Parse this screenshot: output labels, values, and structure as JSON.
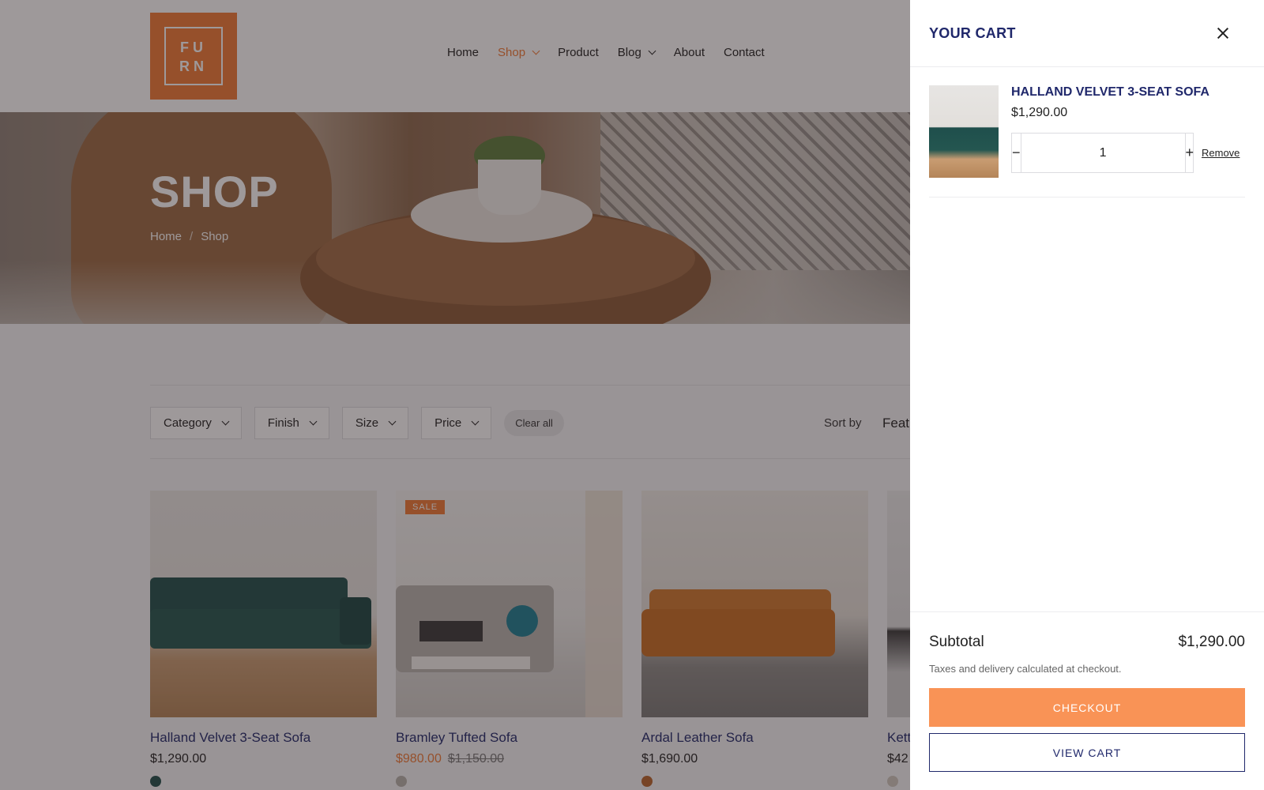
{
  "logo": {
    "line1": "FU",
    "line2": "RN"
  },
  "nav": [
    {
      "label": "Home",
      "active": false,
      "dropdown": false
    },
    {
      "label": "Shop",
      "active": true,
      "dropdown": true
    },
    {
      "label": "Product",
      "active": false,
      "dropdown": false
    },
    {
      "label": "Blog",
      "active": false,
      "dropdown": true
    },
    {
      "label": "About",
      "active": false,
      "dropdown": false
    },
    {
      "label": "Contact",
      "active": false,
      "dropdown": false
    }
  ],
  "hero": {
    "title": "SHOP",
    "breadcrumb": [
      "Home",
      "Shop"
    ],
    "breadcrumb_sep": "/"
  },
  "filters": {
    "buttons": [
      "Category",
      "Finish",
      "Size",
      "Price"
    ],
    "clear_label": "Clear all",
    "sort_label": "Sort by",
    "sort_value": "Feat"
  },
  "products": [
    {
      "name": "Halland Velvet 3-Seat Sofa",
      "price": "$1,290.00",
      "sale_price": "",
      "old_price": "",
      "badge": "",
      "swatch": "#1f4f4c"
    },
    {
      "name": "Bramley Tufted Sofa",
      "price": "",
      "sale_price": "$980.00",
      "old_price": "$1,150.00",
      "badge": "SALE",
      "swatch": "#b7b2ab"
    },
    {
      "name": "Ardal Leather Sofa",
      "price": "$1,690.00",
      "sale_price": "",
      "old_price": "",
      "badge": "",
      "swatch": "#b8652c"
    },
    {
      "name": "Kett",
      "price": "$42",
      "sale_price": "",
      "old_price": "",
      "badge": "",
      "swatch": "#cfc9c0"
    }
  ],
  "cart": {
    "title": "YOUR CART",
    "item": {
      "name": "HALLAND VELVET 3-SEAT SOFA",
      "price": "$1,290.00",
      "quantity": "1",
      "remove_label": "Remove",
      "minus_label": "−",
      "plus_label": "+"
    },
    "subtotal_label": "Subtotal",
    "subtotal_value": "$1,290.00",
    "tax_note": "Taxes and delivery calculated at checkout.",
    "checkout_label": "CHECKOUT",
    "view_cart_label": "VIEW CART"
  },
  "colors": {
    "accent": "#f07a36",
    "checkout": "#f99356",
    "navy": "#20286b"
  }
}
